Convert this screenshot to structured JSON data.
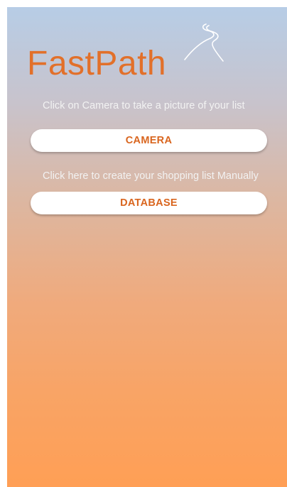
{
  "app": {
    "title": "FastPath",
    "logo_icon": "winding-road-icon",
    "accent_color": "#e2702a"
  },
  "camera": {
    "hint": "Click on Camera to take a picture of your list",
    "button_label": "CAMERA"
  },
  "database": {
    "hint": "Click here to create your shopping list Manually",
    "button_label": "DATABASE"
  }
}
